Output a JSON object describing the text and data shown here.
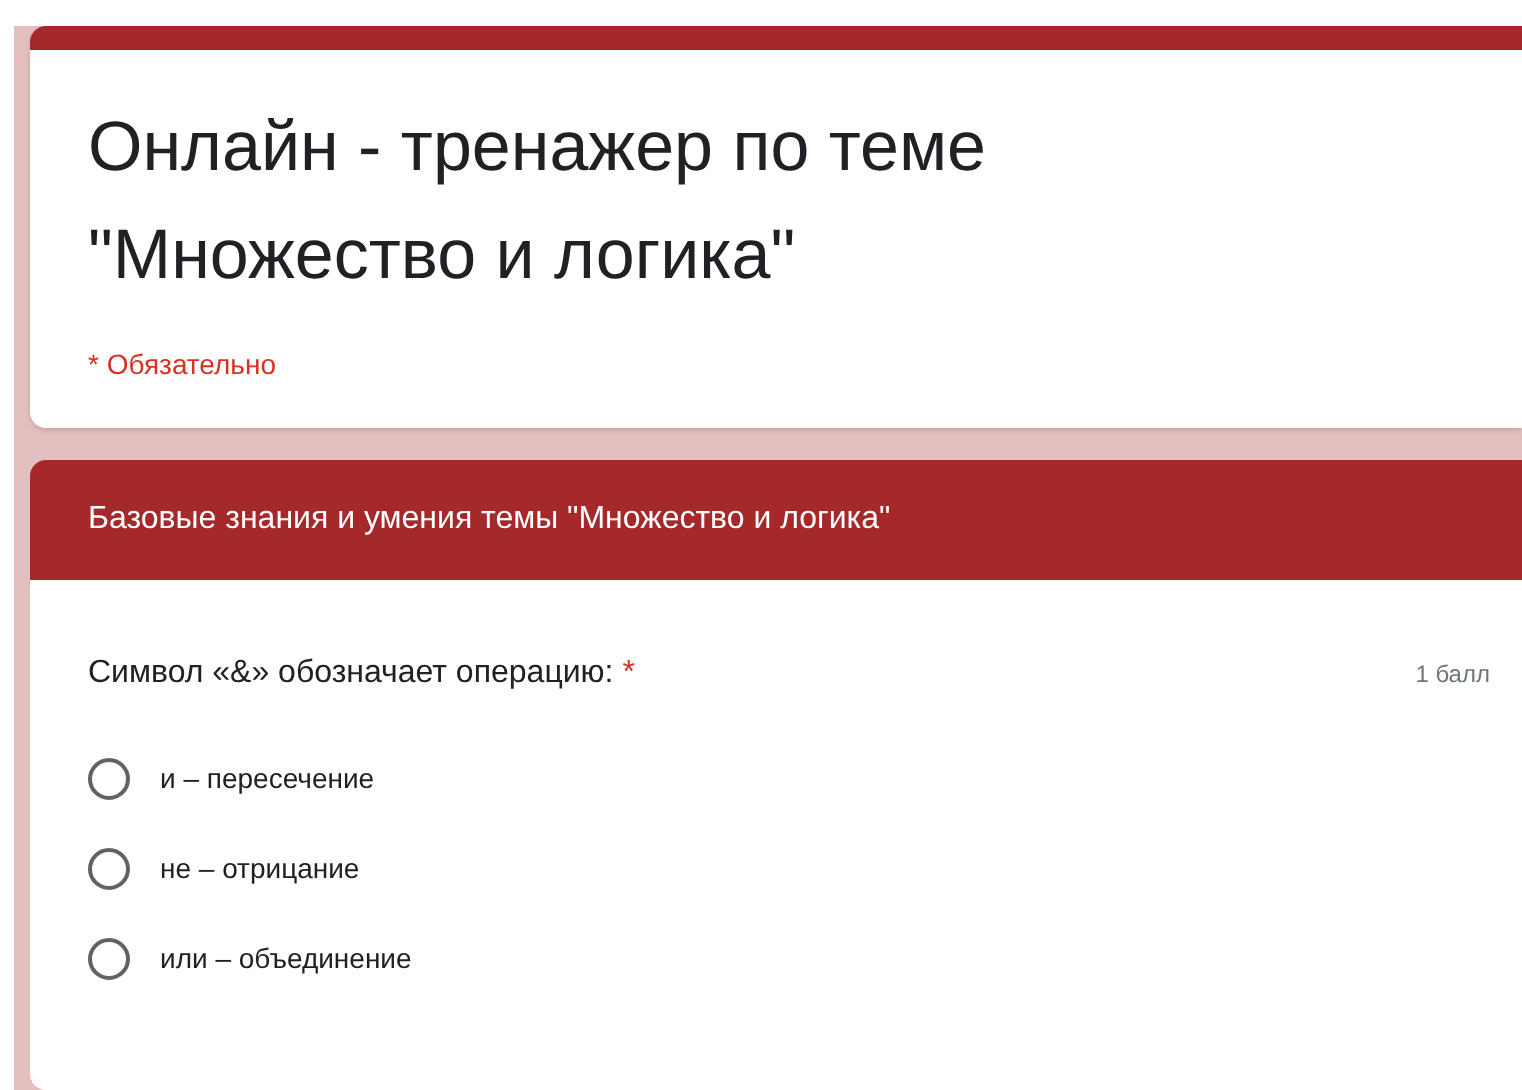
{
  "form": {
    "title": "Онлайн - тренажер по теме \"Множество и логика\"",
    "required_note": "* Обязательно"
  },
  "section": {
    "title": "Базовые знания и умения темы \"Множество и логика\""
  },
  "question": {
    "text": "Символ «&» обозначает операцию:",
    "required_mark": "*",
    "points": "1 балл",
    "options": [
      {
        "label": "и – пересечение",
        "selected": false
      },
      {
        "label": "не – отрицание",
        "selected": false
      },
      {
        "label": "или – объединение",
        "selected": false
      }
    ]
  }
}
